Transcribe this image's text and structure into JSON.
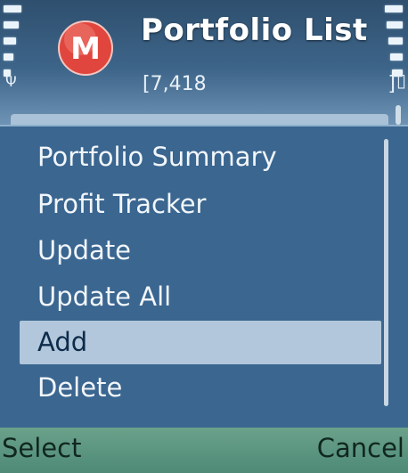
{
  "header": {
    "title": "Portfolio List",
    "subtitle": "[7,418",
    "subtitle_right": "]",
    "app_logo_letter": "M",
    "app_logo_color": "#e0463d",
    "signal_icon": "antenna-icon",
    "battery_icon": "battery-icon"
  },
  "menu": {
    "items": [
      {
        "label": "Portfolio Summary",
        "selected": false
      },
      {
        "label": "Profit Tracker",
        "selected": false
      },
      {
        "label": "Update",
        "selected": false
      },
      {
        "label": "Update All",
        "selected": false
      },
      {
        "label": "Add",
        "selected": true
      },
      {
        "label": "Delete",
        "selected": false
      }
    ]
  },
  "softkeys": {
    "left": "Select",
    "right": "Cancel"
  },
  "colors": {
    "menu_bg": "#3a6690",
    "selected_bg": "#b2c7db",
    "softkey_bg": "#5a957f"
  }
}
